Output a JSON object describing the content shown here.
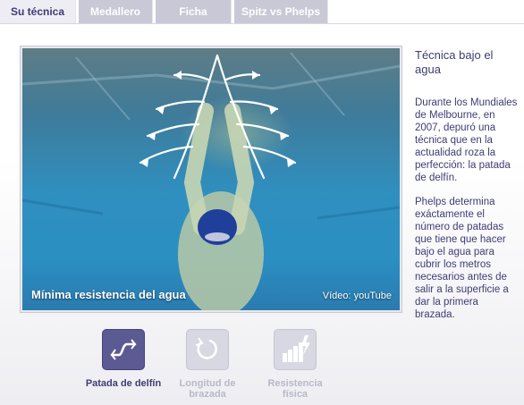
{
  "tabs": [
    {
      "label": "Su técnica",
      "active": true
    },
    {
      "label": "Medallero",
      "active": false
    },
    {
      "label": "Ficha",
      "active": false
    },
    {
      "label": "Spitz vs Phelps",
      "active": false
    }
  ],
  "video": {
    "caption": "Mínima resistencia del agua",
    "credit": "Vídeo: youTube"
  },
  "side": {
    "title": "Técnica bajo el agua",
    "paragraph1": "Durante los Mundiales de Melbourne, en 2007, depuró una técnica que en la actualidad roza la perfección: la patada de delfín.",
    "paragraph2": "Phelps determina exáctamente el número de patadas que tiene que hacer bajo el agua para cubrir los metros necesarios antes de salir a la superficie a dar la primera brazada."
  },
  "options": [
    {
      "label": "Patada de delfín",
      "icon": "dolphin-kick-icon",
      "active": true
    },
    {
      "label": "Longitud de brazada",
      "icon": "rotate-arrow-icon",
      "active": false
    },
    {
      "label": "Resistencia física",
      "icon": "resistance-bars-icon",
      "active": false
    }
  ],
  "colors": {
    "accent": "#3e3c74",
    "tab_inactive": "#c9c8d6",
    "tab_active": "#eeedf4",
    "water": "#2b8fc2"
  }
}
